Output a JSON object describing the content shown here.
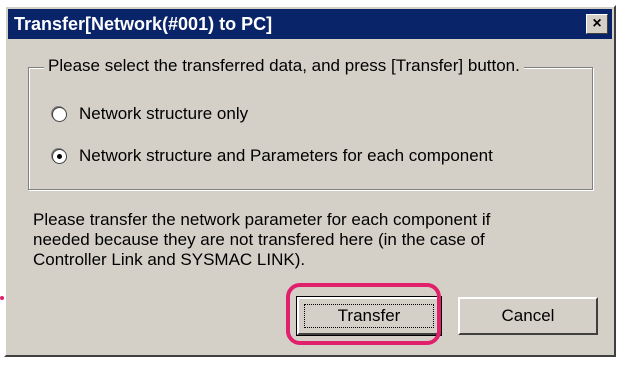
{
  "dialog": {
    "title": "Transfer[Network(#001) to PC]",
    "close_icon": "close-icon",
    "close_glyph": "×"
  },
  "group": {
    "legend": "Please select the transferred data, and press [Transfer] button.",
    "options": [
      {
        "label": "Network structure only",
        "checked": false
      },
      {
        "label": "Network structure and Parameters for each component",
        "checked": true
      }
    ]
  },
  "note": {
    "line1": "Please transfer the network parameter for each component if",
    "line2": "needed because they are not transfered here (in the case of",
    "line3": "Controller Link and SYSMAC LINK)."
  },
  "buttons": {
    "transfer_label": "Transfer",
    "cancel_label": "Cancel"
  },
  "colors": {
    "titlebar": "#0a246a",
    "highlight": "#e0206a",
    "dialog_bg": "#d4d0c8"
  }
}
